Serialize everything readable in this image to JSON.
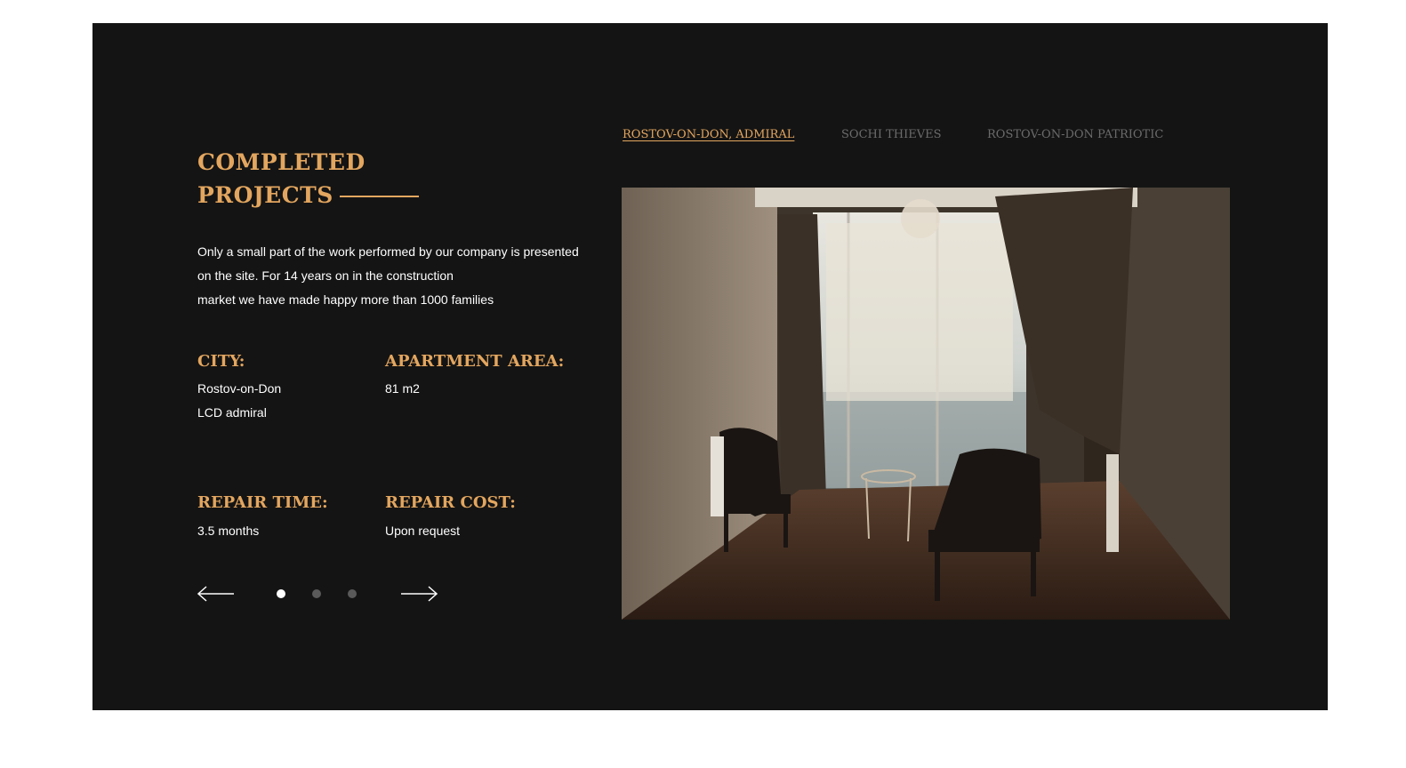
{
  "section": {
    "title_line1": "COMPLETED",
    "title_line2": "PROJECTS",
    "intro_lines": [
      "Only a small part of the work performed by our company is presented",
      "on the site. For 14 years on in the construction",
      "market we have made happy more than 1000 families"
    ]
  },
  "details": {
    "city_label": "CITY:",
    "city_lines": [
      "Rostov-on-Don",
      "LCD admiral"
    ],
    "area_label": "APARTMENT AREA:",
    "area_value": "81 m2",
    "time_label": "REPAIR TIME:",
    "time_value": "3.5 months",
    "cost_label": "REPAIR COST:",
    "cost_value": "Upon request"
  },
  "slider": {
    "prev_icon": "arrow-left-icon",
    "next_icon": "arrow-right-icon",
    "slide_count": 3,
    "active_slide": 1
  },
  "tabs": [
    {
      "label": "ROSTOV-ON-DON, ADMIRAL",
      "active": true
    },
    {
      "label": "SOCHI THIEVES",
      "active": false
    },
    {
      "label": "ROSTOV-ON-DON PATRIOTIC",
      "active": false
    }
  ],
  "colors": {
    "panel_bg": "#141414",
    "accent_gold": "#e3a65f",
    "text_white": "#ffffff",
    "tab_inactive": "#6b6b6b",
    "dot_inactive": "#5a5a5a"
  }
}
